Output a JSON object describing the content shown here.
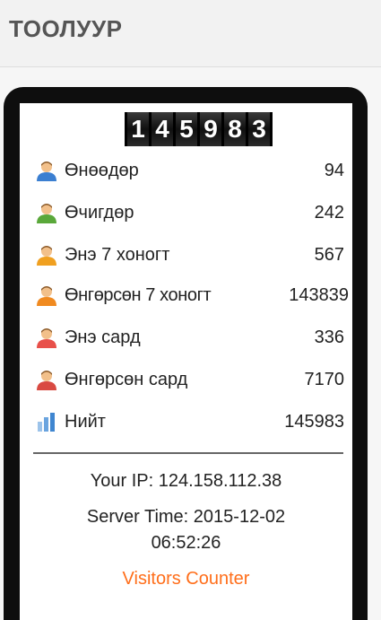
{
  "header": {
    "title": "ТООЛУУР"
  },
  "counter": {
    "digits": [
      "1",
      "4",
      "5",
      "9",
      "8",
      "3"
    ]
  },
  "stats": [
    {
      "label": "Өнөөдөр",
      "value": "94",
      "icon": "user-blue-icon",
      "color": "#3b7fd1"
    },
    {
      "label": "Өчигдөр",
      "value": "242",
      "icon": "user-green-icon",
      "color": "#5aa83a"
    },
    {
      "label": "Энэ 7 хоногт",
      "value": "567",
      "icon": "user-orange-icon",
      "color": "#f0a020"
    },
    {
      "label": "Өнгөрсөн 7 хоногт",
      "value": "143839",
      "icon": "user-orange-icon",
      "color": "#f08a20"
    },
    {
      "label": "Энэ сард",
      "value": "336",
      "icon": "user-red-icon",
      "color": "#e8504a"
    },
    {
      "label": "Өнгөрсөн сард",
      "value": "7170",
      "icon": "user-red-icon",
      "color": "#d94a42"
    },
    {
      "label": "Нийт",
      "value": "145983",
      "icon": "bar-chart-icon",
      "color": "#4a90d9"
    }
  ],
  "info": {
    "ip": "Your IP: 124.158.112.38",
    "server_time_line1": "Server Time: 2015-12-02",
    "server_time_line2": "06:52:26"
  },
  "footer": {
    "link": "Visitors Counter"
  },
  "colors": {
    "accent": "#ff6e1a",
    "frame": "#0e0e0e"
  }
}
